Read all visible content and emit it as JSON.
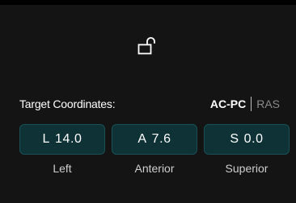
{
  "lock": {
    "icon": "unlocked-padlock-icon",
    "state": "unlocked"
  },
  "target": {
    "label": "Target Coordinates:",
    "system_options": [
      "AC-PC",
      "RAS"
    ],
    "selected_system": "AC-PC"
  },
  "coordinates": [
    {
      "prefix": "L",
      "value": "14.0",
      "caption": "Left"
    },
    {
      "prefix": "A",
      "value": "7.6",
      "caption": "Anterior"
    },
    {
      "prefix": "S",
      "value": "0.0",
      "caption": "Superior"
    }
  ],
  "colors": {
    "panel_bg": "#141414",
    "coord_box_bg": "#0e3236",
    "coord_box_border": "#185055",
    "inactive_text": "#8a8a8a"
  }
}
